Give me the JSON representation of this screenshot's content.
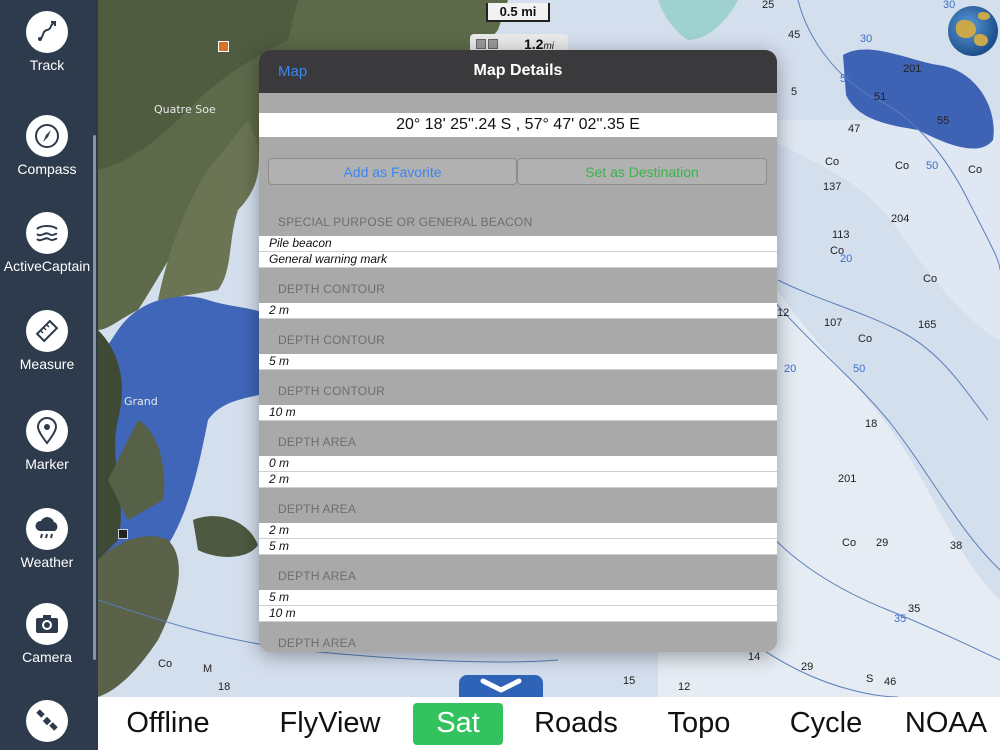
{
  "sidebar": {
    "items": [
      {
        "label": "Track",
        "icon": "track-icon"
      },
      {
        "label": "Compass",
        "icon": "compass-icon"
      },
      {
        "label": "ActiveCaptain",
        "icon": "activecaptain-icon"
      },
      {
        "label": "Measure",
        "icon": "ruler-icon"
      },
      {
        "label": "Marker",
        "icon": "map-pin-icon"
      },
      {
        "label": "Weather",
        "icon": "cloud-rain-icon"
      },
      {
        "label": "Camera",
        "icon": "camera-icon"
      },
      {
        "label": "",
        "icon": "satellite-icon"
      }
    ]
  },
  "map": {
    "scale_text": "0.5 mi",
    "zoom_value": "1.2",
    "zoom_unit": "mi",
    "place_labels": [
      "Quatre Soe",
      "Grand"
    ],
    "depth_labels": [
      "25",
      "45",
      "30",
      "30",
      "201",
      "50",
      "51",
      "55",
      "5",
      "47",
      "Co",
      "Co",
      "50",
      "Co",
      "137",
      "204",
      "113",
      "20",
      "Co",
      "Co",
      "165",
      "Co",
      "107",
      "12",
      "20",
      "50",
      "18",
      "201",
      "35",
      "Co",
      "29",
      "38",
      "35",
      "29",
      "S",
      "46",
      "12",
      "14",
      "15",
      "Co",
      "M",
      "18"
    ]
  },
  "modal": {
    "back_label": "Map",
    "title": "Map Details",
    "coordinates": "20° 18' 25''.24 S  ,  57° 47' 02''.35 E",
    "add_favorite_label": "Add as Favorite",
    "set_destination_label": "Set as Destination",
    "sections": [
      {
        "header": "SPECIAL PURPOSE OR GENERAL BEACON",
        "rows": [
          "Pile beacon",
          "General warning mark"
        ]
      },
      {
        "header": "DEPTH CONTOUR",
        "rows": [
          "2 m"
        ]
      },
      {
        "header": "DEPTH CONTOUR",
        "rows": [
          "5 m"
        ]
      },
      {
        "header": "DEPTH CONTOUR",
        "rows": [
          "10 m"
        ]
      },
      {
        "header": "DEPTH AREA",
        "rows": [
          "0 m",
          "2 m"
        ]
      },
      {
        "header": "DEPTH AREA",
        "rows": [
          "2 m",
          "5 m"
        ]
      },
      {
        "header": "DEPTH AREA",
        "rows": [
          "5 m",
          "10 m"
        ]
      },
      {
        "header": "DEPTH AREA",
        "rows": []
      }
    ]
  },
  "bottom_bar": {
    "tabs": [
      "Offline",
      "FlyView",
      "Sat",
      "Roads",
      "Topo",
      "Cycle",
      "NOAA"
    ],
    "active_tab": "Sat"
  },
  "colors": {
    "sidebar_bg": "#2e3b4c",
    "link_blue": "#3b86f2",
    "destination_green": "#38b54a",
    "active_tab_green": "#32c25e",
    "handle_blue": "#2f63b8"
  }
}
